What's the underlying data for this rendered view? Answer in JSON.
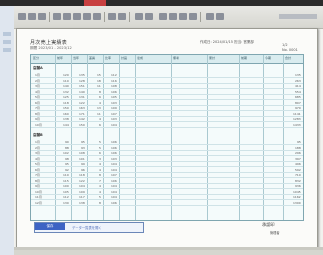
{
  "document": {
    "title": "月次売上実績表",
    "subtitle": "期間 2023/01 - 2023/12",
    "header_right": "作成日: 2024/01/15  担当: 営業部",
    "page_no": "1/2",
    "code": "No. 0001"
  },
  "table": {
    "headers": [
      "区分",
      "前年",
      "当年",
      "差異",
      "比率",
      "計画",
      "達成",
      "備考",
      "累計",
      "前期",
      "今期",
      "合計"
    ],
    "group_a": "店舗A",
    "group_b": "店舗B",
    "rows_a": [
      [
        "1月",
        "120",
        "135",
        "15",
        "112",
        "",
        "",
        "",
        "",
        "",
        "",
        "135"
      ],
      [
        "2月",
        "110",
        "128",
        "18",
        "116",
        "",
        "",
        "",
        "",
        "",
        "",
        "263"
      ],
      [
        "3月",
        "140",
        "151",
        "11",
        "108",
        "",
        "",
        "",
        "",
        "",
        "",
        "414"
      ],
      [
        "4月",
        "132",
        "140",
        "8",
        "106",
        "",
        "",
        "",
        "",
        "",
        "",
        "554"
      ],
      [
        "5月",
        "125",
        "131",
        "6",
        "105",
        "",
        "",
        "",
        "",
        "",
        "",
        "685"
      ],
      [
        "6月",
        "118",
        "122",
        "4",
        "103",
        "",
        "",
        "",
        "",
        "",
        "",
        "807"
      ],
      [
        "7月",
        "150",
        "163",
        "13",
        "109",
        "",
        "",
        "",
        "",
        "",
        "",
        "970"
      ],
      [
        "8月",
        "160",
        "171",
        "11",
        "107",
        "",
        "",
        "",
        "",
        "",
        "",
        "1141"
      ],
      [
        "9月",
        "138",
        "142",
        "4",
        "103",
        "",
        "",
        "",
        "",
        "",
        "",
        "1283"
      ],
      [
        "10月",
        "144",
        "150",
        "6",
        "104",
        "",
        "",
        "",
        "",
        "",
        "",
        "1433"
      ]
    ],
    "rows_b": [
      [
        "1月",
        "90",
        "95",
        "5",
        "106",
        "",
        "",
        "",
        "",
        "",
        "",
        "95"
      ],
      [
        "2月",
        "88",
        "93",
        "5",
        "106",
        "",
        "",
        "",
        "",
        "",
        "",
        "188"
      ],
      [
        "3月",
        "102",
        "108",
        "6",
        "106",
        "",
        "",
        "",
        "",
        "",
        "",
        "296"
      ],
      [
        "4月",
        "98",
        "101",
        "3",
        "103",
        "",
        "",
        "",
        "",
        "",
        "",
        "397"
      ],
      [
        "5月",
        "95",
        "99",
        "4",
        "104",
        "",
        "",
        "",
        "",
        "",
        "",
        "496"
      ],
      [
        "6月",
        "92",
        "96",
        "4",
        "104",
        "",
        "",
        "",
        "",
        "",
        "",
        "592"
      ],
      [
        "7月",
        "110",
        "118",
        "8",
        "107",
        "",
        "",
        "",
        "",
        "",
        "",
        "710"
      ],
      [
        "8月",
        "115",
        "122",
        "7",
        "106",
        "",
        "",
        "",
        "",
        "",
        "",
        "832"
      ],
      [
        "9月",
        "100",
        "104",
        "4",
        "104",
        "",
        "",
        "",
        "",
        "",
        "",
        "936"
      ],
      [
        "10月",
        "105",
        "109",
        "4",
        "104",
        "",
        "",
        "",
        "",
        "",
        "",
        "1045"
      ],
      [
        "11月",
        "112",
        "117",
        "5",
        "104",
        "",
        "",
        "",
        "",
        "",
        "",
        "1162"
      ],
      [
        "12月",
        "130",
        "138",
        "8",
        "106",
        "",
        "",
        "",
        "",
        "",
        "",
        "1300"
      ]
    ]
  },
  "footer": {
    "button_label": "保存",
    "link_label": "データ一覧表を開く",
    "sign": "承認印",
    "sign_sub": "管理者"
  },
  "colors": {
    "accent_blue": "#3d63c4",
    "table_bg": "#f4fbfb",
    "table_border": "#7fa6b0"
  }
}
